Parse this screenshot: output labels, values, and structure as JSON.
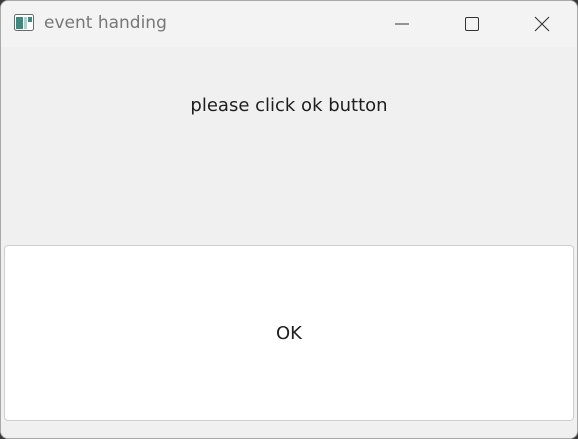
{
  "window": {
    "title": "event handing",
    "icon": "app-window-icon"
  },
  "controls": {
    "minimize": "minimize-icon",
    "maximize": "maximize-icon",
    "close": "close-icon"
  },
  "main": {
    "message": "please click ok button",
    "ok_label": "OK"
  },
  "colors": {
    "window_bg": "#f0f0f0",
    "titlebar_bg": "#f3f3f3",
    "title_text": "#777777",
    "body_text": "#1e1e1e",
    "button_bg": "#ffffff",
    "button_border": "#cfcfcf",
    "icon_accent": "#3b8b82"
  }
}
